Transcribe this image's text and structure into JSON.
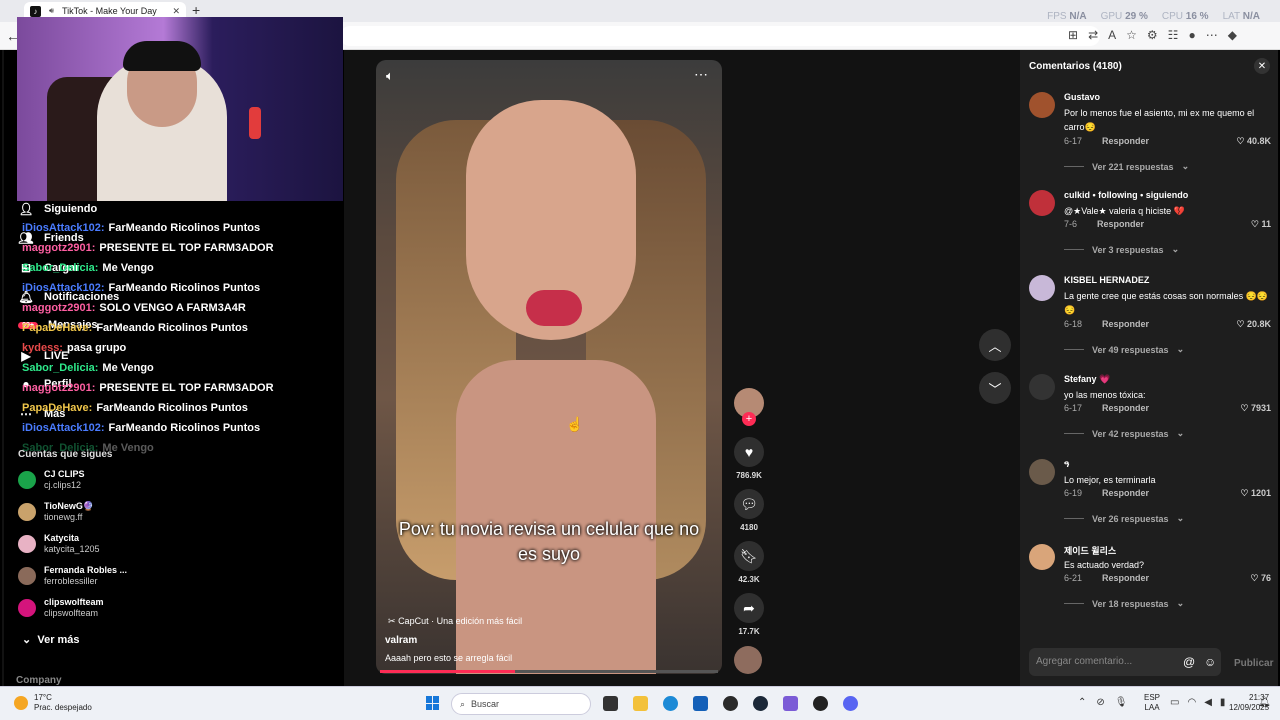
{
  "browser": {
    "tab_title": "TikTok - Make Your Day",
    "perf": [
      {
        "label": "FPS",
        "value": "N/A"
      },
      {
        "label": "GPU",
        "value": "29 %"
      },
      {
        "label": "CPU",
        "value": "16 %"
      },
      {
        "label": "LAT",
        "value": "N/A"
      }
    ]
  },
  "sidebar": {
    "nav": [
      "Siguiendo",
      "Friends",
      "Cargar",
      "Notificaciones",
      "Mensajes",
      "LIVE",
      "Perfil",
      "Más"
    ],
    "messages_badge": "99+",
    "following_title": "Cuentas que sigues",
    "accounts": [
      {
        "name": "CJ CLIPS",
        "handle": "cj.clips12",
        "color": "#1aa34a"
      },
      {
        "name": "TioNewG🔮",
        "handle": "tionewg.ff",
        "color": "#c9a26b"
      },
      {
        "name": "Katycita",
        "handle": "katycita_1205",
        "color": "#e8b2c4"
      },
      {
        "name": "Fernanda Robles ...",
        "handle": "ferroblessiller",
        "color": "#8a6a5a"
      },
      {
        "name": "clipswolfteam",
        "handle": "clipswolfteam",
        "color": "#d4147c"
      }
    ],
    "see_more": "Ver más",
    "company": "Company"
  },
  "chat": [
    {
      "user": "iDiosAttack102:",
      "msg": "FarMeando Ricolinos Puntos",
      "color": "#4a7cff"
    },
    {
      "user": "maggotz2901:",
      "msg": "PRESENTE EL TOP FARM3ADOR",
      "color": "#ff5fa2"
    },
    {
      "user": "Sabor_Delicia:",
      "msg": "Me Vengo",
      "color": "#2ee88a"
    },
    {
      "user": "iDiosAttack102:",
      "msg": "FarMeando Ricolinos Puntos",
      "color": "#4a7cff"
    },
    {
      "user": "maggotz2901:",
      "msg": "SOLO VENGO A FARM3A4R",
      "color": "#ff5fa2"
    },
    {
      "user": "PapaDeHave:",
      "msg": "FarMeando Ricolinos Puntos",
      "color": "#f0c64a"
    },
    {
      "user": "kydess:",
      "msg": "pasa grupo",
      "color": "#e84a4a"
    },
    {
      "user": "Sabor_Delicia:",
      "msg": "Me Vengo",
      "color": "#2ee88a"
    },
    {
      "user": "maggotz2901:",
      "msg": "PRESENTE EL TOP FARM3ADOR",
      "color": "#ff5fa2"
    },
    {
      "user": "PapaDeHave:",
      "msg": "FarMeando Ricolinos Puntos",
      "color": "#f0c64a"
    },
    {
      "user": "iDiosAttack102:",
      "msg": "FarMeando Ricolinos Puntos",
      "color": "#4a7cff"
    },
    {
      "user": "Sabor_Delicia:",
      "msg": "Me Vengo",
      "color": "#2ee88a"
    }
  ],
  "video": {
    "caption": "Pov: tu novia revisa un celular que no es suyo",
    "capcut": "CapCut · Una edición más fácil",
    "author": "valram",
    "description": "Aaaah pero esto se arregla fácil",
    "progress": 0.4
  },
  "actions": {
    "likes": "786.9K",
    "comments": "4180",
    "saves": "42.3K",
    "shares": "17.7K"
  },
  "comments": {
    "title": "Comentarios (4180)",
    "reply_label": "Responder",
    "items": [
      {
        "user": "Gustavo",
        "text": "Por lo menos fue el asiento, mi ex me quemo el carro😔",
        "date": "6-17",
        "likes": "40.8K",
        "replies": "Ver 221 respuestas",
        "color": "#a0522d"
      },
      {
        "user": "culkid • following • siguiendo",
        "text": "@★Vale★ valeria q hiciste 💔",
        "date": "7-6",
        "likes": "11",
        "replies": "Ver 3 respuestas",
        "color": "#c0303a"
      },
      {
        "user": "KISBEL HERNADEZ",
        "text": "La gente cree que estás cosas son normales 😔😔😔",
        "date": "6-18",
        "likes": "20.8K",
        "replies": "Ver 49 respuestas",
        "color": "#c8b8d8"
      },
      {
        "user": "Stefany 💗",
        "text": "yo las menos tóxica:",
        "date": "6-17",
        "likes": "7931",
        "replies": "Ver 42 respuestas",
        "color": "#333333"
      },
      {
        "user": "ዓ",
        "text": "Lo mejor, es terminarla",
        "date": "6-19",
        "likes": "1201",
        "replies": "Ver 26 respuestas",
        "color": "#6a5a4a"
      },
      {
        "user": "제이드 윌리스",
        "text": "Es actuado verdad?",
        "date": "6-21",
        "likes": "76",
        "replies": "Ver 18 respuestas",
        "color": "#d9a57a"
      }
    ],
    "input_placeholder": "Agregar comentario...",
    "publish": "Publicar"
  },
  "taskbar": {
    "temp": "17°C",
    "weather": "Prac. despejado",
    "search_placeholder": "Buscar",
    "lang1": "ESP",
    "lang2": "LAA",
    "time": "21:37",
    "date": "12/09/2025"
  },
  "colors": {
    "accent": "#fe2c55",
    "page_bg": "#121212",
    "comments_bg": "#1e1e1e"
  }
}
